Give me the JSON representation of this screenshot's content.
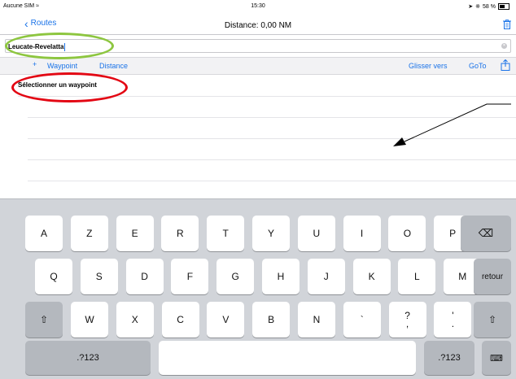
{
  "status_bar": {
    "carrier": "Aucune SIM",
    "time": "15:30",
    "battery": "58 %"
  },
  "nav": {
    "back_label": "Routes",
    "title": "Distance: 0,00 NM"
  },
  "route_name": {
    "value": "Leucate-Revelatta"
  },
  "toolbar": {
    "add": "+",
    "waypoint_label": "Waypoint",
    "distance_label": "Distance",
    "glisser_label": "Glisser vers",
    "goto_label": "GoTo"
  },
  "list": {
    "first_row": "Sélectionner un waypoint"
  },
  "keyboard": {
    "row1": [
      "A",
      "Z",
      "E",
      "R",
      "T",
      "Y",
      "U",
      "I",
      "O",
      "P"
    ],
    "row2": [
      "Q",
      "S",
      "D",
      "F",
      "G",
      "H",
      "J",
      "K",
      "L",
      "M"
    ],
    "row3": [
      "W",
      "X",
      "C",
      "V",
      "B",
      "N",
      "`"
    ],
    "q_top": "?",
    "q_bottom": ",",
    "a_top": "'",
    "a_bottom": ".",
    "return_label": "retour",
    "numbers_label": ".?123"
  },
  "annotations": {
    "green_oval_color": "#8dc63f",
    "red_oval_color": "#e30613",
    "arrow_color": "#000000"
  }
}
